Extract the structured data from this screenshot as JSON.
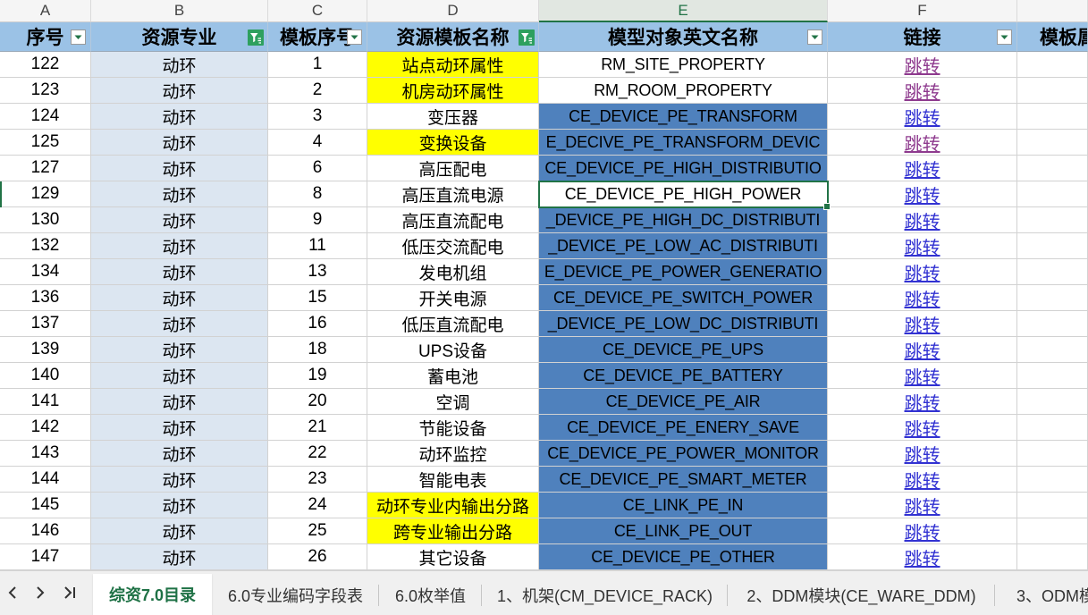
{
  "column_letters": [
    "A",
    "B",
    "C",
    "D",
    "E",
    "F",
    ""
  ],
  "selection": {
    "column": "E",
    "row_seq": "129"
  },
  "headers": [
    {
      "label": "序号",
      "filter": "filter-dropdown-icon"
    },
    {
      "label": "资源专业",
      "filter": "filter-active-icon"
    },
    {
      "label": "模板序号",
      "filter": "filter-dropdown-icon"
    },
    {
      "label": "资源模板名称",
      "filter": "filter-active-icon"
    },
    {
      "label": "模型对象英文名称",
      "filter": "filter-dropdown-icon"
    },
    {
      "label": "链接",
      "filter": "filter-dropdown-icon"
    },
    {
      "label": "模板属",
      "filter": null
    }
  ],
  "rows": [
    {
      "seq": "122",
      "domain": "动环",
      "tpl_no": "1",
      "tpl_name": "站点动环属性",
      "name_highlight": true,
      "model": "RM_SITE_PROPERTY",
      "model_highlight": false,
      "link": "跳转",
      "visited": true
    },
    {
      "seq": "123",
      "domain": "动环",
      "tpl_no": "2",
      "tpl_name": "机房动环属性",
      "name_highlight": true,
      "model": "RM_ROOM_PROPERTY",
      "model_highlight": false,
      "link": "跳转",
      "visited": true
    },
    {
      "seq": "124",
      "domain": "动环",
      "tpl_no": "3",
      "tpl_name": "变压器",
      "name_highlight": false,
      "model": "CE_DEVICE_PE_TRANSFORM",
      "model_highlight": true,
      "link": "跳转",
      "visited": false
    },
    {
      "seq": "125",
      "domain": "动环",
      "tpl_no": "4",
      "tpl_name": "变换设备",
      "name_highlight": true,
      "model": "E_DECIVE_PE_TRANSFORM_DEVIC",
      "model_highlight": true,
      "link": "跳转",
      "visited": true
    },
    {
      "seq": "127",
      "domain": "动环",
      "tpl_no": "6",
      "tpl_name": "高压配电",
      "name_highlight": false,
      "model": "CE_DEVICE_PE_HIGH_DISTRIBUTIO",
      "model_highlight": true,
      "link": "跳转",
      "visited": false
    },
    {
      "seq": "129",
      "domain": "动环",
      "tpl_no": "8",
      "tpl_name": "高压直流电源",
      "name_highlight": false,
      "model": "CE_DEVICE_PE_HIGH_POWER",
      "model_highlight": false,
      "link": "跳转",
      "visited": false
    },
    {
      "seq": "130",
      "domain": "动环",
      "tpl_no": "9",
      "tpl_name": "高压直流配电",
      "name_highlight": false,
      "model": "_DEVICE_PE_HIGH_DC_DISTRIBUTI",
      "model_highlight": true,
      "link": "跳转",
      "visited": false
    },
    {
      "seq": "132",
      "domain": "动环",
      "tpl_no": "11",
      "tpl_name": "低压交流配电",
      "name_highlight": false,
      "model": "_DEVICE_PE_LOW_AC_DISTRIBUTI",
      "model_highlight": true,
      "link": "跳转",
      "visited": false
    },
    {
      "seq": "134",
      "domain": "动环",
      "tpl_no": "13",
      "tpl_name": "发电机组",
      "name_highlight": false,
      "model": "E_DEVICE_PE_POWER_GENERATIO",
      "model_highlight": true,
      "link": "跳转",
      "visited": false
    },
    {
      "seq": "136",
      "domain": "动环",
      "tpl_no": "15",
      "tpl_name": "开关电源",
      "name_highlight": false,
      "model": "CE_DEVICE_PE_SWITCH_POWER",
      "model_highlight": true,
      "link": "跳转",
      "visited": false
    },
    {
      "seq": "137",
      "domain": "动环",
      "tpl_no": "16",
      "tpl_name": "低压直流配电",
      "name_highlight": false,
      "model": "_DEVICE_PE_LOW_DC_DISTRIBUTI",
      "model_highlight": true,
      "link": "跳转",
      "visited": false
    },
    {
      "seq": "139",
      "domain": "动环",
      "tpl_no": "18",
      "tpl_name": "UPS设备",
      "name_highlight": false,
      "model": "CE_DEVICE_PE_UPS",
      "model_highlight": true,
      "link": "跳转",
      "visited": false
    },
    {
      "seq": "140",
      "domain": "动环",
      "tpl_no": "19",
      "tpl_name": "蓄电池",
      "name_highlight": false,
      "model": "CE_DEVICE_PE_BATTERY",
      "model_highlight": true,
      "link": "跳转",
      "visited": false
    },
    {
      "seq": "141",
      "domain": "动环",
      "tpl_no": "20",
      "tpl_name": "空调",
      "name_highlight": false,
      "model": "CE_DEVICE_PE_AIR",
      "model_highlight": true,
      "link": "跳转",
      "visited": false
    },
    {
      "seq": "142",
      "domain": "动环",
      "tpl_no": "21",
      "tpl_name": "节能设备",
      "name_highlight": false,
      "model": "CE_DEVICE_PE_ENERY_SAVE",
      "model_highlight": true,
      "link": "跳转",
      "visited": false
    },
    {
      "seq": "143",
      "domain": "动环",
      "tpl_no": "22",
      "tpl_name": "动环监控",
      "name_highlight": false,
      "model": "CE_DEVICE_PE_POWER_MONITOR",
      "model_highlight": true,
      "link": "跳转",
      "visited": false
    },
    {
      "seq": "144",
      "domain": "动环",
      "tpl_no": "23",
      "tpl_name": "智能电表",
      "name_highlight": false,
      "model": "CE_DEVICE_PE_SMART_METER",
      "model_highlight": true,
      "link": "跳转",
      "visited": false
    },
    {
      "seq": "145",
      "domain": "动环",
      "tpl_no": "24",
      "tpl_name": "动环专业内输出分路",
      "name_highlight": true,
      "model": "CE_LINK_PE_IN",
      "model_highlight": true,
      "link": "跳转",
      "visited": false
    },
    {
      "seq": "146",
      "domain": "动环",
      "tpl_no": "25",
      "tpl_name": "跨专业输出分路",
      "name_highlight": true,
      "model": "CE_LINK_PE_OUT",
      "model_highlight": true,
      "link": "跳转",
      "visited": false
    },
    {
      "seq": "147",
      "domain": "动环",
      "tpl_no": "26",
      "tpl_name": "其它设备",
      "name_highlight": false,
      "model": "CE_DEVICE_PE_OTHER",
      "model_highlight": true,
      "link": "跳转",
      "visited": false
    }
  ],
  "colors": {
    "header_fill": "#9bc2e6",
    "domain_fill": "#dce6f1",
    "highlight_yellow": "#ffff00",
    "model_blue": "#4f81bd",
    "link": "#3232d2",
    "link_visited": "#8e3a8e",
    "accent_green": "#217346",
    "filter_active": "#2ea05f"
  },
  "sheet_tabs": {
    "nav": [
      {
        "icon": "chevron-left-icon"
      },
      {
        "icon": "chevron-right-icon"
      },
      {
        "icon": "chevron-last-icon"
      }
    ],
    "tabs": [
      {
        "label": "综资7.0目录",
        "active": true
      },
      {
        "label": "6.0专业编码字段表",
        "active": false
      },
      {
        "label": "6.0枚举值",
        "active": false
      },
      {
        "label": "1、机架(CM_DEVICE_RACK)",
        "active": false
      },
      {
        "label": "2、DDM模块(CE_WARE_DDM)",
        "active": false
      },
      {
        "label": "3、ODM模",
        "active": false
      }
    ]
  }
}
